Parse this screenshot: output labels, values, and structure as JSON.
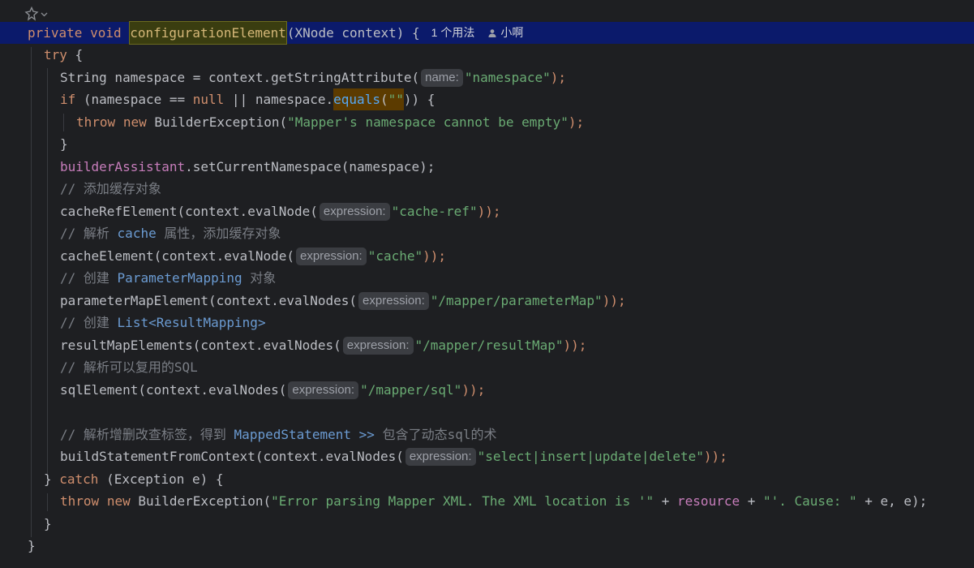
{
  "header": {
    "usage_hint": "1 个用法",
    "author": "小啊"
  },
  "code": {
    "l1_private": "private",
    "l1_void": "void",
    "l1_method": "configurationElement",
    "l1_rest": "(XNode context) {",
    "l2_try": "try",
    "l2_brace": " {",
    "l3_a": "String namespace = context.getStringAttribute(",
    "l3_hint": "name:",
    "l3_str": "\"namespace\"",
    "l3_end": ");",
    "l4_if": "if",
    "l4_a": " (namespace == ",
    "l4_null": "null",
    "l4_b": " || namespace.",
    "l4_equals": "equals",
    "l4_c": "(",
    "l4_str": "\"\"",
    "l4_d": ")) {",
    "l5_throw": "throw",
    "l5_new": "new",
    "l5_a": " BuilderException(",
    "l5_str": "\"Mapper's namespace cannot be empty\"",
    "l5_end": ");",
    "l6": "}",
    "l7_field": "builderAssistant",
    "l7_rest": ".setCurrentNamespace(namespace);",
    "l8_cmt": "// 添加缓存对象",
    "l9_a": "cacheRefElement(context.evalNode(",
    "l9_hint": "expression:",
    "l9_str": "\"cache-ref\"",
    "l9_end": "));",
    "l10_cmt_a": "// 解析 ",
    "l10_cmt_code": "cache",
    "l10_cmt_b": " 属性，添加缓存对象",
    "l11_a": "cacheElement(context.evalNode(",
    "l11_hint": "expression:",
    "l11_str": "\"cache\"",
    "l11_end": "));",
    "l12_cmt_a": "// 创建 ",
    "l12_cmt_code": "ParameterMapping",
    "l12_cmt_b": " 对象",
    "l13_a": "parameterMapElement(context.evalNodes(",
    "l13_hint": "expression:",
    "l13_str": "\"/mapper/parameterMap\"",
    "l13_end": "));",
    "l14_cmt_a": "// 创建 ",
    "l14_cmt_code": "List<ResultMapping>",
    "l15_a": "resultMapElements(context.evalNodes(",
    "l15_hint": "expression:",
    "l15_str": "\"/mapper/resultMap\"",
    "l15_end": "));",
    "l16_cmt": "// 解析可以复用的SQL",
    "l17_a": "sqlElement(context.evalNodes(",
    "l17_hint": "expression:",
    "l17_str": "\"/mapper/sql\"",
    "l17_end": "));",
    "l19_cmt_a": "// 解析增删改查标签，得到 ",
    "l19_cmt_code": "MappedStatement >>",
    "l19_cmt_b": " 包含了动态sql的术",
    "l20_a": "buildStatementFromContext(context.evalNodes(",
    "l20_hint": "expression:",
    "l20_str": "\"select|insert|update|delete\"",
    "l20_end": "));",
    "l21_a": "} ",
    "l21_catch": "catch",
    "l21_b": " (Exception e) {",
    "l22_throw": "throw",
    "l22_new": "new",
    "l22_a": " BuilderException(",
    "l22_str1": "\"Error parsing Mapper XML. The XML location is '\"",
    "l22_b": " + ",
    "l22_field": "resource",
    "l22_c": " + ",
    "l22_str2": "\"'. Cause: \"",
    "l22_d": " + e, e);",
    "l23": "}",
    "l24": "}"
  },
  "colors": {
    "background": "#1e1f22",
    "keyword": "#cf8e6d",
    "function": "#56a8f5",
    "string": "#6aab73",
    "comment": "#7a7e85",
    "field": "#c77dbb",
    "active_line": "#0b1a6b"
  },
  "icons": {
    "gutter": "ai-assistant-icon",
    "author": "person-icon"
  }
}
